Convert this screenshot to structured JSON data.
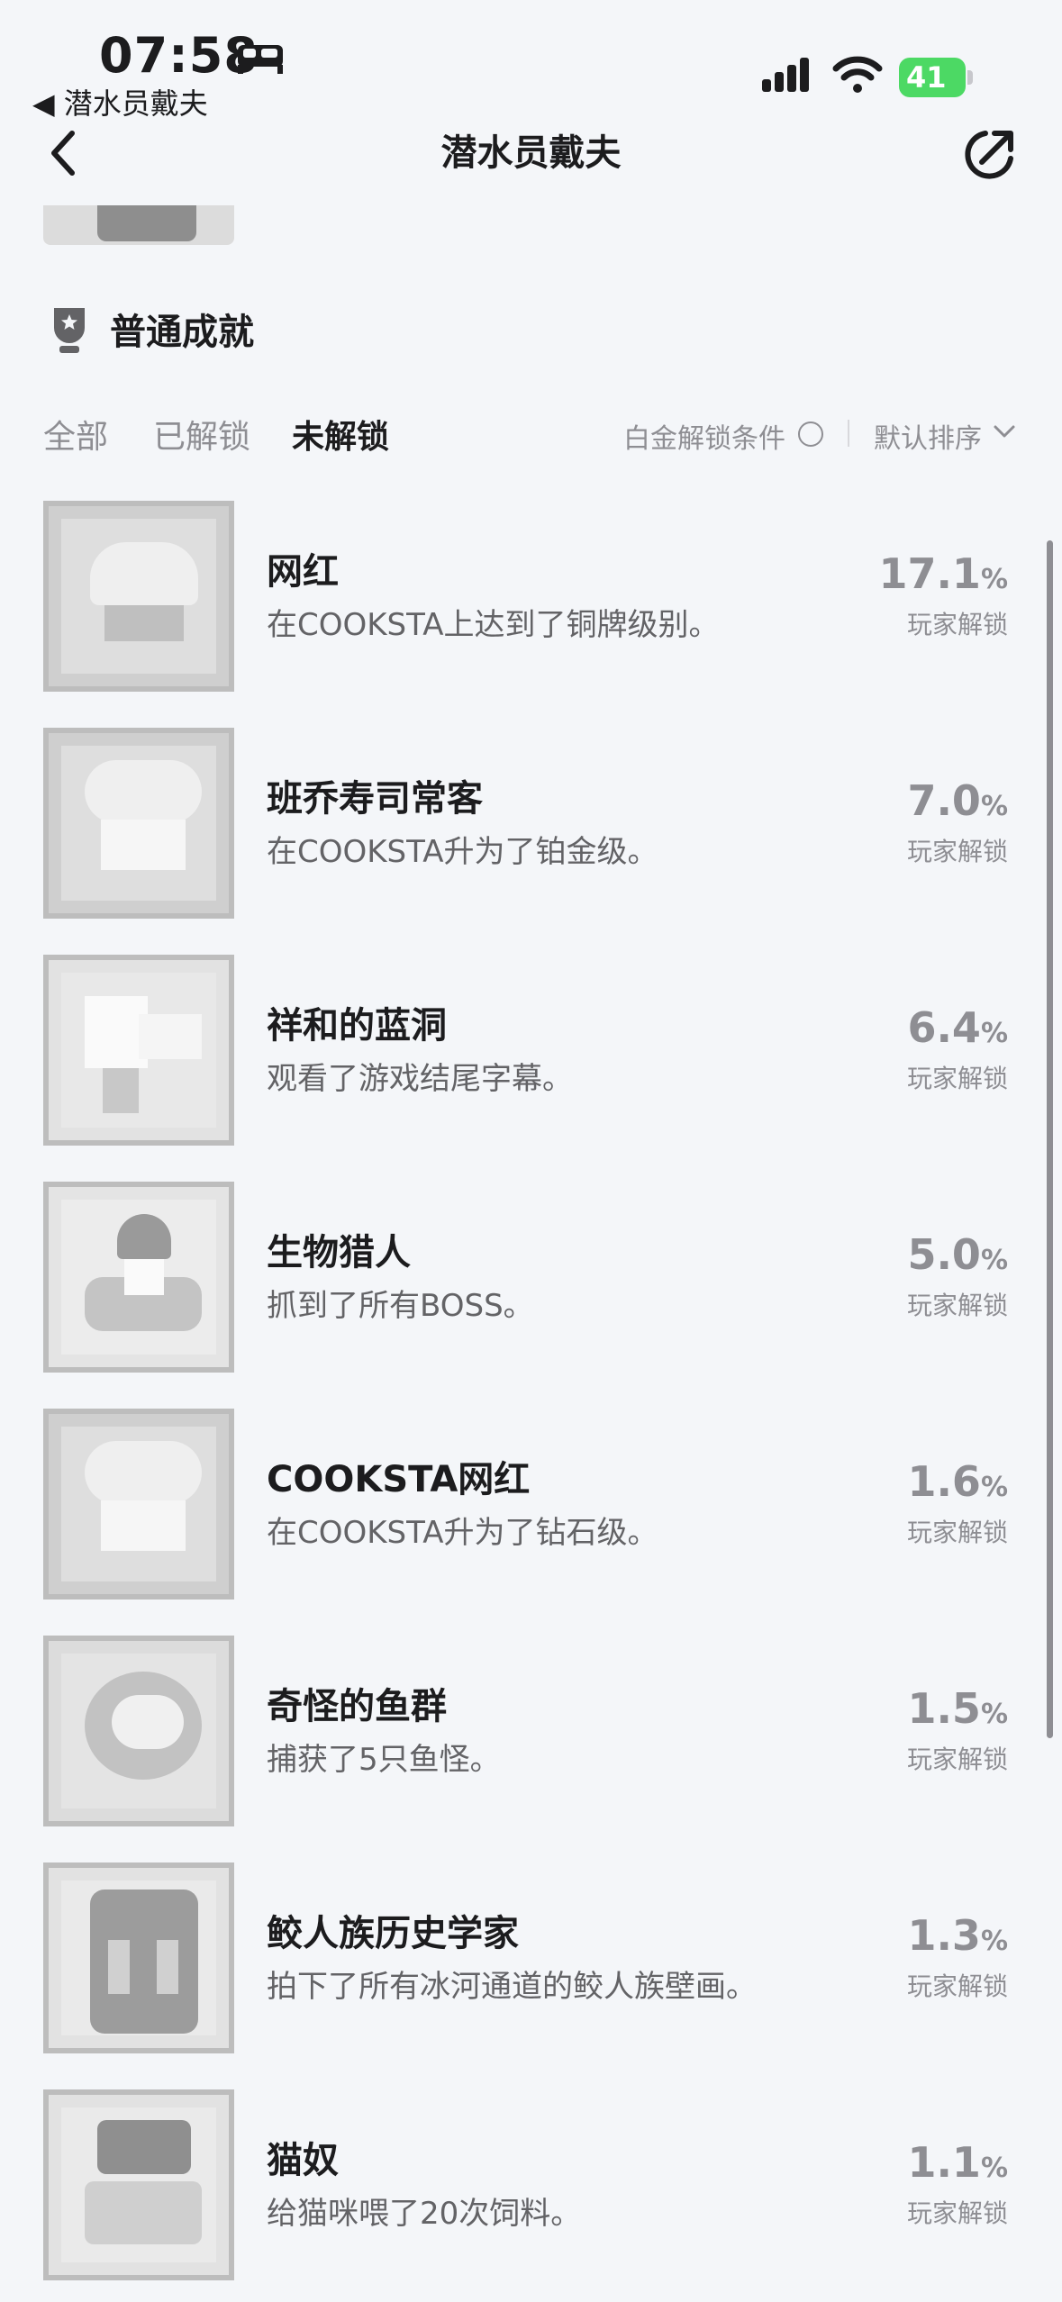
{
  "status_bar": {
    "time": "07:58",
    "back_app": "◀ 潜水员戴夫",
    "battery": "41"
  },
  "nav": {
    "title": "潜水员戴夫"
  },
  "section": {
    "title": "普通成就"
  },
  "filters": {
    "tabs": [
      "全部",
      "已解锁",
      "未解锁"
    ],
    "active_tab": "未解锁",
    "platinum_label": "白金解锁条件",
    "sort_label": "默认排序"
  },
  "achievements": [
    {
      "name": "网红",
      "desc": "在COOKSTA上达到了铜牌级别。",
      "percent": "17.1",
      "unit": "%",
      "caption": "玩家解锁"
    },
    {
      "name": "班乔寿司常客",
      "desc": "在COOKSTA升为了铂金级。",
      "percent": "7.0",
      "unit": "%",
      "caption": "玩家解锁"
    },
    {
      "name": "祥和的蓝洞",
      "desc": "观看了游戏结尾字幕。",
      "percent": "6.4",
      "unit": "%",
      "caption": "玩家解锁"
    },
    {
      "name": "生物猎人",
      "desc": "抓到了所有BOSS。",
      "percent": "5.0",
      "unit": "%",
      "caption": "玩家解锁"
    },
    {
      "name": "COOKSTA网红",
      "desc": "在COOKSTA升为了钻石级。",
      "percent": "1.6",
      "unit": "%",
      "caption": "玩家解锁"
    },
    {
      "name": "奇怪的鱼群",
      "desc": "捕获了5只鱼怪。",
      "percent": "1.5",
      "unit": "%",
      "caption": "玩家解锁"
    },
    {
      "name": "鲛人族历史学家",
      "desc": "拍下了所有冰河通道的鲛人族壁画。",
      "percent": "1.3",
      "unit": "%",
      "caption": "玩家解锁"
    },
    {
      "name": "猫奴",
      "desc": "给猫咪喂了20次饲料。",
      "percent": "1.1",
      "unit": "%",
      "caption": "玩家解锁"
    }
  ]
}
